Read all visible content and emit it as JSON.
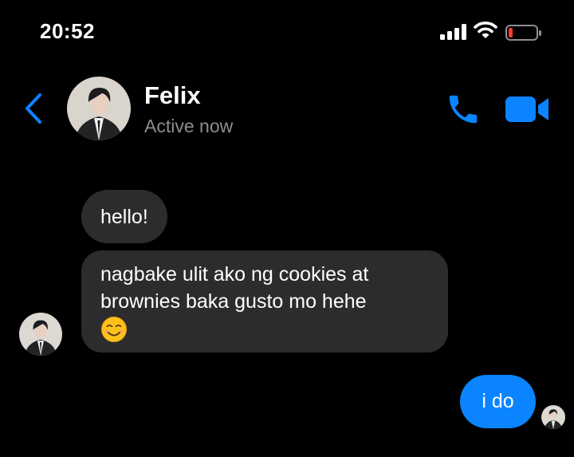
{
  "status_bar": {
    "time": "20:52"
  },
  "header": {
    "contact_name": "Felix",
    "contact_status": "Active now",
    "icons": [
      "back-chevron-icon",
      "phone-icon",
      "video-camera-icon"
    ]
  },
  "messages": [
    {
      "from": "Felix",
      "text": "hello!"
    },
    {
      "from": "Felix",
      "text": "nagbake ulit ako ng cookies at brownies baka gusto mo hehe",
      "emoji": "smiling-face-icon"
    },
    {
      "from": "me",
      "text": "i do"
    }
  ],
  "colors": {
    "accent": "#0a84ff",
    "incoming_bubble": "#2c2c2e",
    "background": "#000000",
    "secondary_text": "#8d8d93",
    "battery_low": "#ff3b30"
  }
}
